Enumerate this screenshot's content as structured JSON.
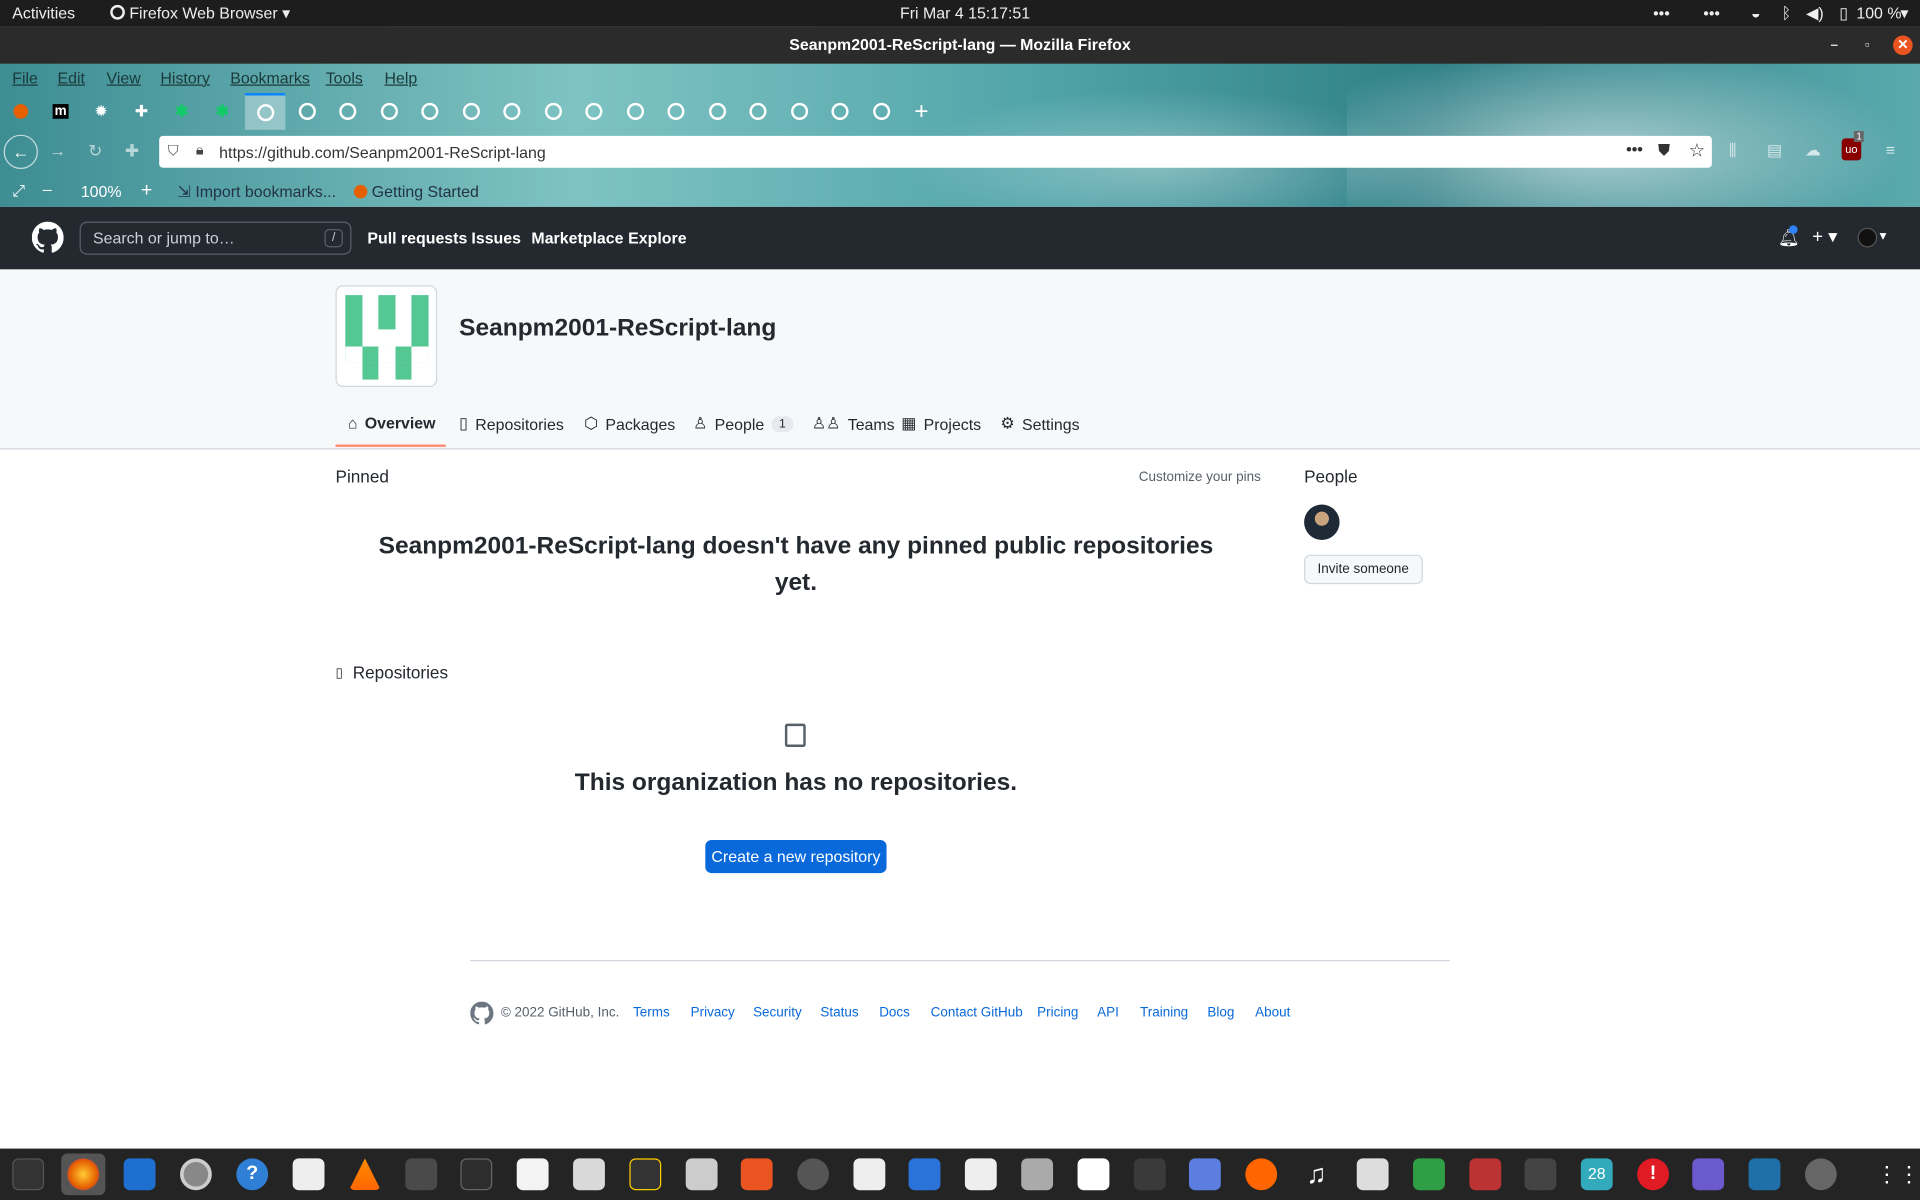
{
  "system": {
    "activities": "Activities",
    "app_menu": "Firefox Web Browser",
    "clock": "Fri Mar 4  15:17:51",
    "battery": "100 %"
  },
  "browser": {
    "window_title": "Seanpm2001-ReScript-lang — Mozilla Firefox",
    "menu": [
      "File",
      "Edit",
      "View",
      "History",
      "Bookmarks",
      "Tools",
      "Help"
    ],
    "url": "https://github.com/Seanpm2001-ReScript-lang",
    "zoom": "100%",
    "bookmarks": [
      "Import bookmarks...",
      "Getting Started"
    ],
    "addon_badge": "1"
  },
  "github": {
    "search_placeholder": "Search or jump to…",
    "search_key": "/",
    "nav": [
      "Pull requests",
      "Issues",
      "Marketplace",
      "Explore"
    ]
  },
  "org": {
    "name": "Seanpm2001-ReScript-lang",
    "tabs": [
      "Overview",
      "Repositories",
      "Packages",
      "People",
      "Teams",
      "Projects",
      "Settings"
    ],
    "people_count": "1"
  },
  "main": {
    "pinned_label": "Pinned",
    "customize_pins": "Customize your pins",
    "no_pins_line1": "Seanpm2001-ReScript-lang doesn't have any pinned public repositories",
    "no_pins_line2": "yet.",
    "repos_label": "Repositories",
    "no_repos": "This organization has no repositories.",
    "create_repo": "Create a new repository"
  },
  "sidebar": {
    "people_label": "People",
    "invite": "Invite someone"
  },
  "footer": {
    "copyright": "© 2022 GitHub, Inc.",
    "links": [
      "Terms",
      "Privacy",
      "Security",
      "Status",
      "Docs",
      "Contact GitHub",
      "Pricing",
      "API",
      "Training",
      "Blog",
      "About"
    ]
  },
  "taskbar": {
    "calendar_day": "28"
  }
}
